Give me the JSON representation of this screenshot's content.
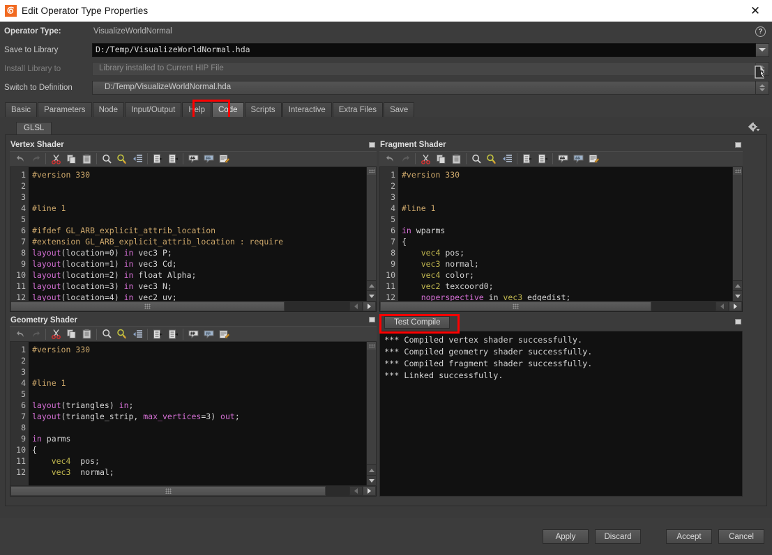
{
  "window": {
    "title": "Edit Operator Type Properties",
    "logo_icon": "houdini-logo-icon",
    "close_icon": "close-icon"
  },
  "header": {
    "operator_type_label": "Operator Type:",
    "operator_type_value": "VisualizeWorldNormal",
    "save_to_library_label": "Save to Library",
    "save_to_library_value": "D:/Temp/VisualizeWorldNormal.hda",
    "install_library_label": "Install Library to",
    "install_library_value": "Library installed to Current HIP File",
    "switch_to_definition_label": "Switch to Definition",
    "switch_to_definition_value": "D:/Temp/VisualizeWorldNormal.hda",
    "help_icon": "help-icon",
    "help_glyph": "?",
    "browse_icon": "file-browse-icon",
    "dropdown_icon": "chevron-down-icon"
  },
  "tabs": [
    {
      "label": "Basic",
      "active": false
    },
    {
      "label": "Parameters",
      "active": false
    },
    {
      "label": "Node",
      "active": false
    },
    {
      "label": "Input/Output",
      "active": false
    },
    {
      "label": "Help",
      "active": false
    },
    {
      "label": "Code",
      "active": true
    },
    {
      "label": "Scripts",
      "active": false
    },
    {
      "label": "Interactive",
      "active": false
    },
    {
      "label": "Extra Files",
      "active": false
    },
    {
      "label": "Save",
      "active": false
    }
  ],
  "glsl": {
    "tab_label": "GLSL",
    "gear_icon": "gear-dropdown-icon"
  },
  "toolbar_icons": [
    "undo-icon",
    "redo-icon",
    "cut-icon",
    "copy-icon",
    "paste-icon",
    "find-icon",
    "find-replace-icon",
    "indent-icon",
    "shift-right-icon",
    "shift-left-icon",
    "comment-icon",
    "uncomment-icon",
    "edit-notes-icon"
  ],
  "panels": {
    "vertex": {
      "title": "Vertex Shader",
      "lines": [
        {
          "n": 1,
          "tokens": [
            {
              "t": "#version 330",
              "c": "pp"
            }
          ]
        },
        {
          "n": 2,
          "tokens": []
        },
        {
          "n": 3,
          "tokens": []
        },
        {
          "n": 4,
          "tokens": [
            {
              "t": "#line 1",
              "c": "pp"
            }
          ]
        },
        {
          "n": 5,
          "tokens": []
        },
        {
          "n": 6,
          "tokens": [
            {
              "t": "#ifdef GL_ARB_explicit_attrib_location",
              "c": "pp"
            }
          ]
        },
        {
          "n": 7,
          "tokens": [
            {
              "t": "#extension GL_ARB_explicit_attrib_location : require",
              "c": "pp"
            }
          ]
        },
        {
          "n": 8,
          "tokens": [
            {
              "t": "layout",
              "c": "kw"
            },
            {
              "t": "(location=0) ",
              "c": "pl"
            },
            {
              "t": "in",
              "c": "kw"
            },
            {
              "t": " vec3 P;",
              "c": "pl"
            }
          ]
        },
        {
          "n": 9,
          "tokens": [
            {
              "t": "layout",
              "c": "kw"
            },
            {
              "t": "(location=1) ",
              "c": "pl"
            },
            {
              "t": "in",
              "c": "kw"
            },
            {
              "t": " vec3 Cd;",
              "c": "pl"
            }
          ]
        },
        {
          "n": 10,
          "tokens": [
            {
              "t": "layout",
              "c": "kw"
            },
            {
              "t": "(location=2) ",
              "c": "pl"
            },
            {
              "t": "in",
              "c": "kw"
            },
            {
              "t": " float Alpha;",
              "c": "pl"
            }
          ]
        },
        {
          "n": 11,
          "tokens": [
            {
              "t": "layout",
              "c": "kw"
            },
            {
              "t": "(location=3) ",
              "c": "pl"
            },
            {
              "t": "in",
              "c": "kw"
            },
            {
              "t": " vec3 N;",
              "c": "pl"
            }
          ]
        },
        {
          "n": 12,
          "tokens": [
            {
              "t": "layout",
              "c": "kw"
            },
            {
              "t": "(location=4) ",
              "c": "pl"
            },
            {
              "t": "in",
              "c": "kw"
            },
            {
              "t": " vec2 uv;",
              "c": "pl"
            }
          ]
        }
      ]
    },
    "fragment": {
      "title": "Fragment Shader",
      "lines": [
        {
          "n": 1,
          "tokens": [
            {
              "t": "#version 330",
              "c": "pp"
            }
          ]
        },
        {
          "n": 2,
          "tokens": []
        },
        {
          "n": 3,
          "tokens": []
        },
        {
          "n": 4,
          "tokens": [
            {
              "t": "#line 1",
              "c": "pp"
            }
          ]
        },
        {
          "n": 5,
          "tokens": []
        },
        {
          "n": 6,
          "tokens": [
            {
              "t": "in",
              "c": "kw"
            },
            {
              "t": " wparms",
              "c": "pl"
            }
          ]
        },
        {
          "n": 7,
          "tokens": [
            {
              "t": "{",
              "c": "pl"
            }
          ]
        },
        {
          "n": 8,
          "tokens": [
            {
              "t": "    ",
              "c": "pl"
            },
            {
              "t": "vec4",
              "c": "ty"
            },
            {
              "t": " pos;",
              "c": "pl"
            }
          ]
        },
        {
          "n": 9,
          "tokens": [
            {
              "t": "    ",
              "c": "pl"
            },
            {
              "t": "vec3",
              "c": "ty"
            },
            {
              "t": " normal;",
              "c": "pl"
            }
          ]
        },
        {
          "n": 10,
          "tokens": [
            {
              "t": "    ",
              "c": "pl"
            },
            {
              "t": "vec4",
              "c": "ty"
            },
            {
              "t": " color;",
              "c": "pl"
            }
          ]
        },
        {
          "n": 11,
          "tokens": [
            {
              "t": "    ",
              "c": "pl"
            },
            {
              "t": "vec2",
              "c": "ty"
            },
            {
              "t": " texcoord0;",
              "c": "pl"
            }
          ]
        },
        {
          "n": 12,
          "tokens": [
            {
              "t": "    ",
              "c": "pl"
            },
            {
              "t": "noperspective",
              "c": "kw"
            },
            {
              "t": " in ",
              "c": "pl"
            },
            {
              "t": "vec3",
              "c": "ty"
            },
            {
              "t": " edgedist;",
              "c": "pl"
            }
          ]
        }
      ]
    },
    "geometry": {
      "title": "Geometry Shader",
      "lines": [
        {
          "n": 1,
          "tokens": [
            {
              "t": "#version 330",
              "c": "pp"
            }
          ]
        },
        {
          "n": 2,
          "tokens": []
        },
        {
          "n": 3,
          "tokens": []
        },
        {
          "n": 4,
          "tokens": [
            {
              "t": "#line 1",
              "c": "pp"
            }
          ]
        },
        {
          "n": 5,
          "tokens": []
        },
        {
          "n": 6,
          "tokens": [
            {
              "t": "layout",
              "c": "kw"
            },
            {
              "t": "(triangles) ",
              "c": "pl"
            },
            {
              "t": "in",
              "c": "kw"
            },
            {
              "t": ";",
              "c": "pl"
            }
          ]
        },
        {
          "n": 7,
          "tokens": [
            {
              "t": "layout",
              "c": "kw"
            },
            {
              "t": "(triangle_strip, ",
              "c": "pl"
            },
            {
              "t": "max_vertices",
              "c": "kw"
            },
            {
              "t": "=3) ",
              "c": "pl"
            },
            {
              "t": "out",
              "c": "kw"
            },
            {
              "t": ";",
              "c": "pl"
            }
          ]
        },
        {
          "n": 8,
          "tokens": []
        },
        {
          "n": 9,
          "tokens": [
            {
              "t": "in",
              "c": "kw"
            },
            {
              "t": " parms",
              "c": "pl"
            }
          ]
        },
        {
          "n": 10,
          "tokens": [
            {
              "t": "{",
              "c": "pl"
            }
          ]
        },
        {
          "n": 11,
          "tokens": [
            {
              "t": "    ",
              "c": "pl"
            },
            {
              "t": "vec4",
              "c": "ty"
            },
            {
              "t": "  pos;",
              "c": "pl"
            }
          ]
        },
        {
          "n": 12,
          "tokens": [
            {
              "t": "    ",
              "c": "pl"
            },
            {
              "t": "vec3",
              "c": "ty"
            },
            {
              "t": "  normal;",
              "c": "pl"
            }
          ]
        }
      ]
    }
  },
  "compile": {
    "button_label": "Test Compile",
    "output": "*** Compiled vertex shader successfully.\n*** Compiled geometry shader successfully.\n*** Compiled fragment shader successfully.\n*** Linked successfully."
  },
  "footer": {
    "apply": "Apply",
    "discard": "Discard",
    "accept": "Accept",
    "cancel": "Cancel"
  },
  "highlight_color": "#fe0000"
}
